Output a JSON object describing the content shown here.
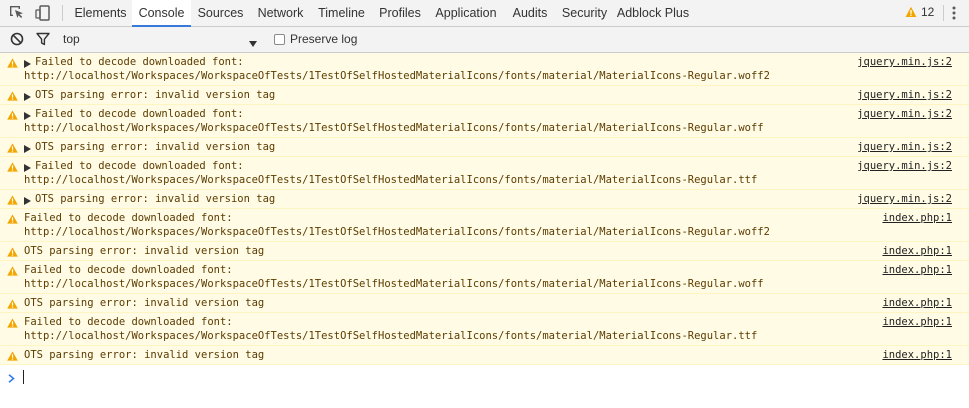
{
  "toolbar": {
    "tabs": [
      {
        "label": "Elements",
        "active": false
      },
      {
        "label": "Console",
        "active": true
      },
      {
        "label": "Sources",
        "active": false
      },
      {
        "label": "Network",
        "active": false
      },
      {
        "label": "Timeline",
        "active": false
      },
      {
        "label": "Profiles",
        "active": false
      },
      {
        "label": "Application",
        "active": false
      },
      {
        "label": "Audits",
        "active": false
      },
      {
        "label": "Security",
        "active": false
      },
      {
        "label": "Adblock Plus",
        "active": false
      }
    ],
    "warning_count": "12",
    "icons": [
      "inspect-element-icon",
      "device-toolbar-icon",
      "warning-icon",
      "more-menu-icon"
    ]
  },
  "filterbar": {
    "context": "top",
    "preserve_log_label": "Preserve log",
    "preserve_log_checked": false,
    "icons": [
      "clear-console-icon",
      "filter-icon",
      "dropdown-arrow-icon"
    ]
  },
  "messages": [
    {
      "line1": "Failed to decode downloaded font:",
      "line2": "http://localhost/Workspaces/WorkspaceOfTests/1TestOfSelfHostedMaterialIcons/fonts/material/MaterialIcons-Regular.woff2",
      "source": "jquery.min.js:2"
    },
    {
      "line1": "OTS parsing error: invalid version tag",
      "source": "jquery.min.js:2"
    },
    {
      "line1": "Failed to decode downloaded font:",
      "line2": "http://localhost/Workspaces/WorkspaceOfTests/1TestOfSelfHostedMaterialIcons/fonts/material/MaterialIcons-Regular.woff",
      "source": "jquery.min.js:2"
    },
    {
      "line1": "OTS parsing error: invalid version tag",
      "source": "jquery.min.js:2"
    },
    {
      "line1": "Failed to decode downloaded font:",
      "line2": "http://localhost/Workspaces/WorkspaceOfTests/1TestOfSelfHostedMaterialIcons/fonts/material/MaterialIcons-Regular.ttf",
      "source": "jquery.min.js:2"
    },
    {
      "line1": "OTS parsing error: invalid version tag",
      "source": "jquery.min.js:2"
    },
    {
      "line1": "Failed to decode downloaded font:",
      "line2": "http://localhost/Workspaces/WorkspaceOfTests/1TestOfSelfHostedMaterialIcons/fonts/material/MaterialIcons-Regular.woff2",
      "source": "index.php:1"
    },
    {
      "line1": "OTS parsing error: invalid version tag",
      "source": "index.php:1"
    },
    {
      "line1": "Failed to decode downloaded font:",
      "line2": "http://localhost/Workspaces/WorkspaceOfTests/1TestOfSelfHostedMaterialIcons/fonts/material/MaterialIcons-Regular.woff",
      "source": "index.php:1"
    },
    {
      "line1": "OTS parsing error: invalid version tag",
      "source": "index.php:1"
    },
    {
      "line1": "Failed to decode downloaded font:",
      "line2": "http://localhost/Workspaces/WorkspaceOfTests/1TestOfSelfHostedMaterialIcons/fonts/material/MaterialIcons-Regular.ttf",
      "source": "index.php:1"
    },
    {
      "line1": "OTS parsing error: invalid version tag",
      "source": "index.php:1"
    }
  ],
  "colors": {
    "warning_background": "#fffbe5",
    "warning_text": "#5c3c00",
    "warning_icon": "#f2a600",
    "active_tab_underline": "#3879d9",
    "prompt_chevron": "#367cf1"
  }
}
